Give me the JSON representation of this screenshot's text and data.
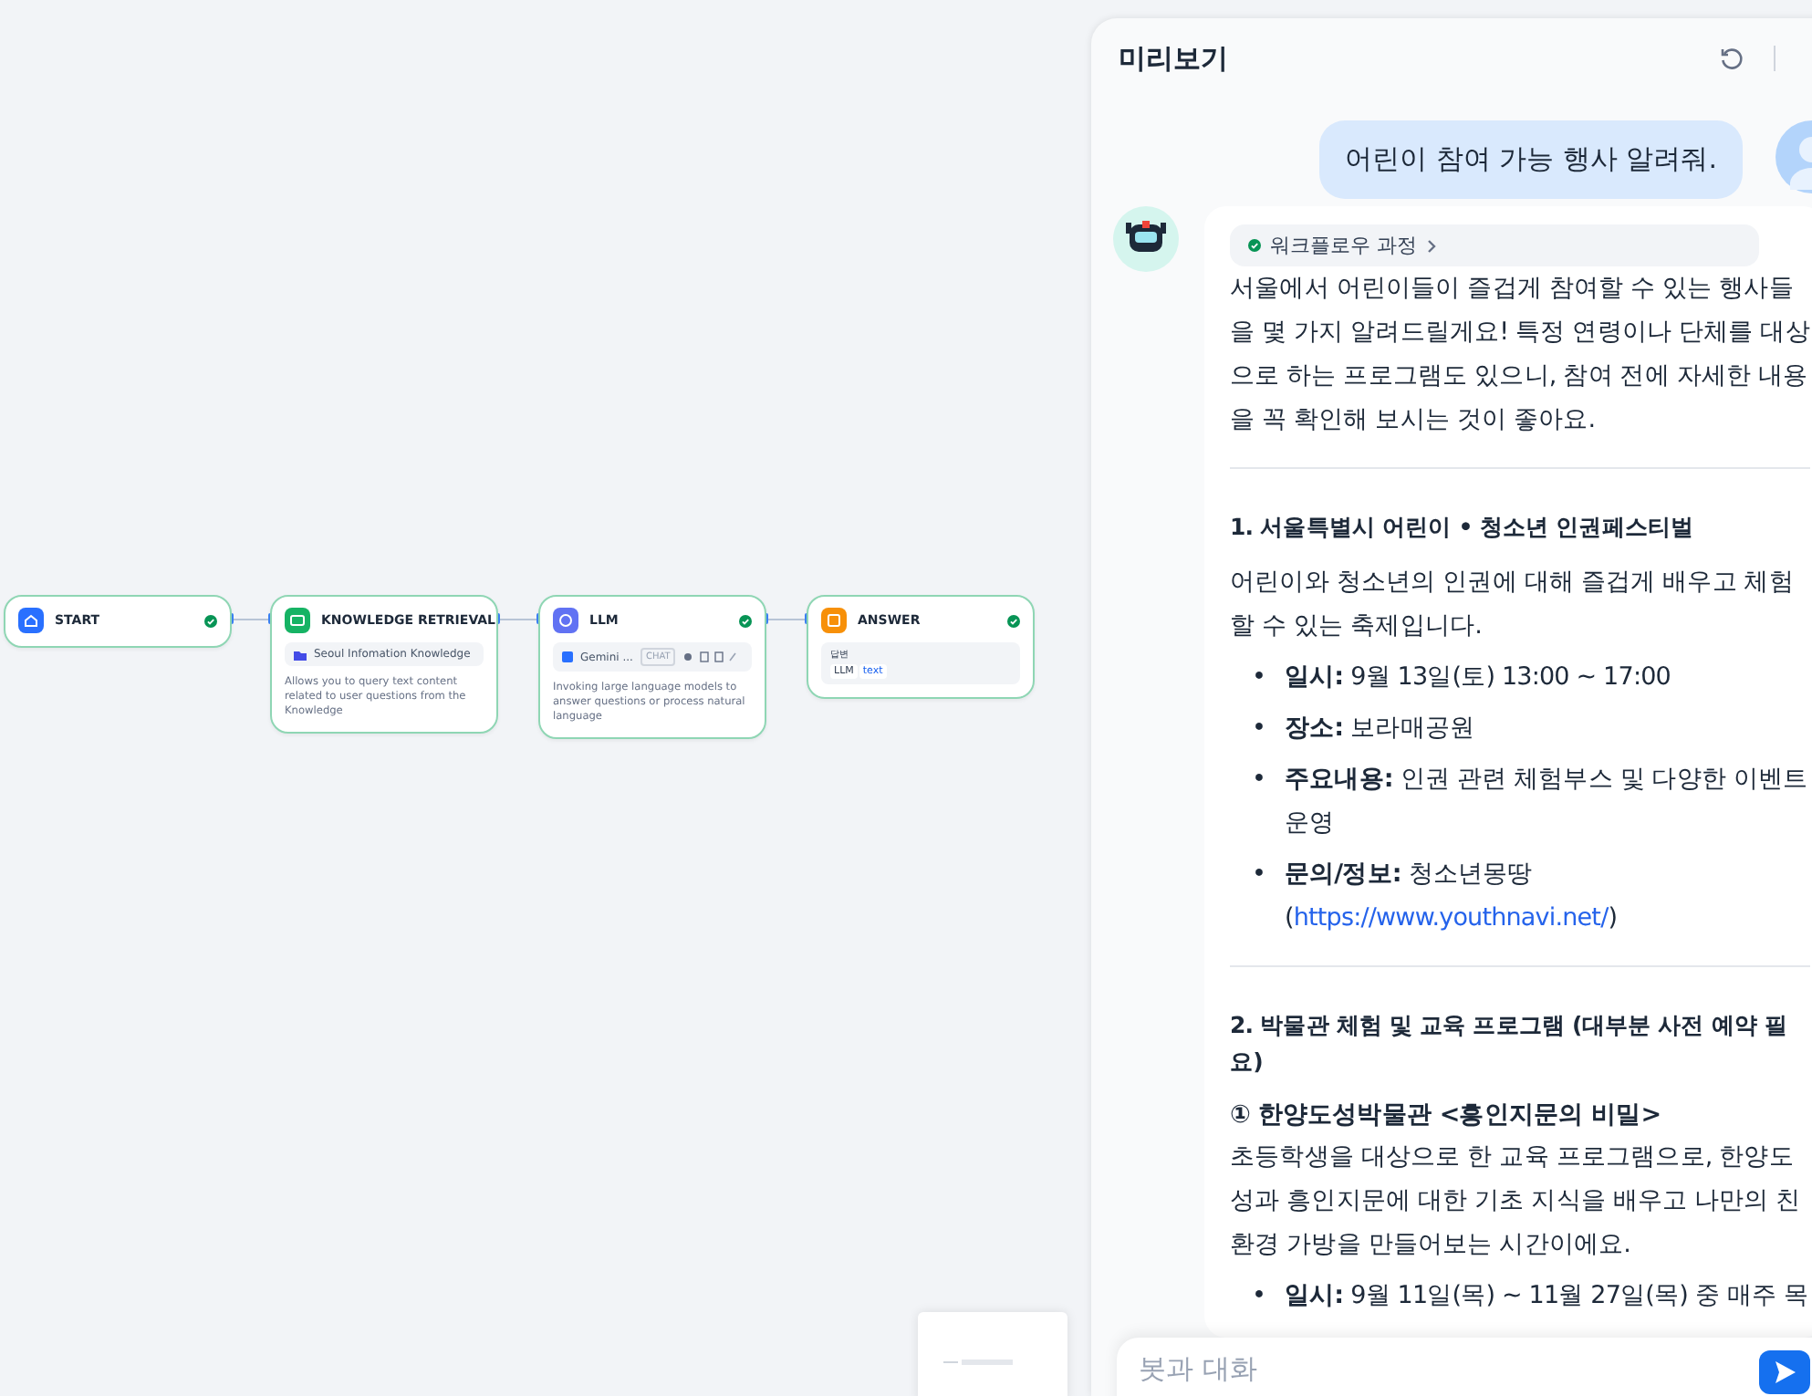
{
  "canvas": {
    "nodes": [
      {
        "kind": "start",
        "title": "START"
      },
      {
        "kind": "knowledge",
        "title": "KNOWLEDGE RETRIEVAL",
        "chip": "Seoul Infomation Knowledge",
        "description": "Allows you to query text content related to user questions from the Knowledge"
      },
      {
        "kind": "llm",
        "title": "LLM",
        "chip": "Gemini ...",
        "badge": "CHAT",
        "description": "Invoking large language models to answer questions or process natural language"
      },
      {
        "kind": "answer",
        "title": "ANSWER",
        "field_label": "답변",
        "vars": [
          "LLM",
          "text"
        ]
      }
    ]
  },
  "preview": {
    "title": "미리보기",
    "user_message": "어린이 참여 가능 행사 알려줘.",
    "workflow_badge": "워크플로우 과정",
    "content": [
      {
        "kind": "paragraph",
        "text": "서울에서 어린이들이 즐겁게 참여할 수 있는 행사들을 몇 가지 알려드릴게요! 특정 연령이나 단체를 대상으로 하는 프로그램도 있으니, 참여 전에 자세한 내용을 꼭 확인해 보시는 것이 좋아요."
      },
      {
        "kind": "divider"
      },
      {
        "kind": "heading",
        "text": "1. 서울특별시 어린이 • 청소년 인권페스티벌"
      },
      {
        "kind": "paragraph",
        "text": "어린이와 청소년의 인권에 대해 즐겁게 배우고 체험할 수 있는 축제입니다."
      },
      {
        "kind": "bullet",
        "marker": "•",
        "label": "일시:",
        "text": "9월 13일(토) 13:00 ~ 17:00"
      },
      {
        "kind": "bullet",
        "marker": "•",
        "label": "장소:",
        "text": "보라매공원"
      },
      {
        "kind": "bullet",
        "marker": "•",
        "label": "주요내용:",
        "text": "인권 관련 체험부스 및 다양한 이벤트 운영"
      },
      {
        "kind": "bullet",
        "marker": "•",
        "label": "문의/정보:",
        "text": "청소년몽땅 (",
        "link": "https://www.youthnavi.net/",
        "after": ")"
      },
      {
        "kind": "divider"
      },
      {
        "kind": "heading",
        "text": "2. 박물관 체험 및 교육 프로그램 (대부분 사전 예약 필요)"
      },
      {
        "kind": "subheading",
        "text": "① 한양도성박물관 <흥인지문의 비밀>"
      },
      {
        "kind": "paragraph",
        "text": "초등학생을 대상으로 한 교육 프로그램으로, 한양도성과 흥인지문에 대한 기초 지식을 배우고 나만의 친환경 가방을 만들어보는 시간이에요."
      },
      {
        "kind": "bullet",
        "marker": "•",
        "label": "일시:",
        "text": "9월 11일(목) ~ 11월 27일(목) 중 매주 목"
      }
    ],
    "input": {
      "placeholder": "봇과 대화"
    }
  }
}
